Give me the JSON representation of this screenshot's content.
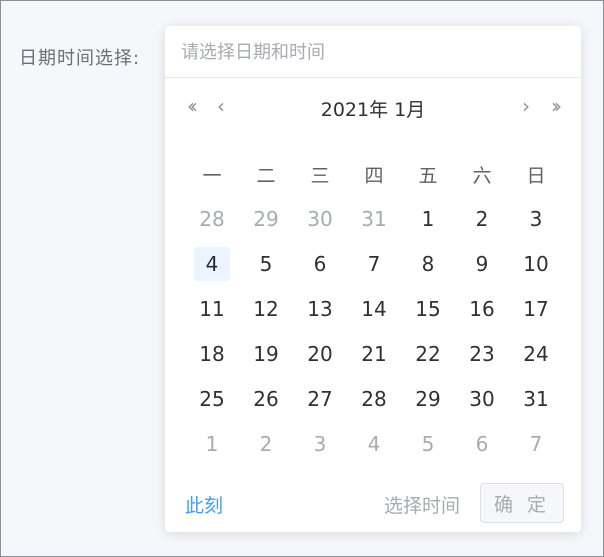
{
  "form": {
    "label": "日期时间选择:"
  },
  "input": {
    "placeholder": "请选择日期和时间",
    "value": ""
  },
  "header": {
    "prev_year_icon": "double-chevron-left-icon",
    "prev_month_icon": "chevron-left-icon",
    "next_month_icon": "chevron-right-icon",
    "next_year_icon": "double-chevron-right-icon",
    "prev_year_glyph": "‹‹",
    "prev_month_glyph": "‹",
    "next_month_glyph": "›",
    "next_year_glyph": "››",
    "year_label": "2021年",
    "month_label": "1月"
  },
  "weekdays": [
    "一",
    "二",
    "三",
    "四",
    "五",
    "六",
    "日"
  ],
  "weeks": [
    [
      {
        "d": "28",
        "muted": true
      },
      {
        "d": "29",
        "muted": true
      },
      {
        "d": "30",
        "muted": true
      },
      {
        "d": "31",
        "muted": true
      },
      {
        "d": "1"
      },
      {
        "d": "2"
      },
      {
        "d": "3"
      }
    ],
    [
      {
        "d": "4",
        "selected": true
      },
      {
        "d": "5"
      },
      {
        "d": "6"
      },
      {
        "d": "7"
      },
      {
        "d": "8"
      },
      {
        "d": "9"
      },
      {
        "d": "10"
      }
    ],
    [
      {
        "d": "11"
      },
      {
        "d": "12"
      },
      {
        "d": "13"
      },
      {
        "d": "14"
      },
      {
        "d": "15"
      },
      {
        "d": "16"
      },
      {
        "d": "17"
      }
    ],
    [
      {
        "d": "18"
      },
      {
        "d": "19"
      },
      {
        "d": "20"
      },
      {
        "d": "21"
      },
      {
        "d": "22"
      },
      {
        "d": "23"
      },
      {
        "d": "24"
      }
    ],
    [
      {
        "d": "25"
      },
      {
        "d": "26"
      },
      {
        "d": "27"
      },
      {
        "d": "28"
      },
      {
        "d": "29"
      },
      {
        "d": "30"
      },
      {
        "d": "31"
      }
    ],
    [
      {
        "d": "1",
        "muted": true
      },
      {
        "d": "2",
        "muted": true
      },
      {
        "d": "3",
        "muted": true
      },
      {
        "d": "4",
        "muted": true
      },
      {
        "d": "5",
        "muted": true
      },
      {
        "d": "6",
        "muted": true
      },
      {
        "d": "7",
        "muted": true
      }
    ]
  ],
  "footer": {
    "now_label": "此刻",
    "pick_time_label": "选择时间",
    "confirm_label": "确 定"
  },
  "colors": {
    "accent": "#409eff",
    "selected_bg": "#ecf5ff",
    "muted_text": "#a8abb2",
    "text": "#303133"
  }
}
